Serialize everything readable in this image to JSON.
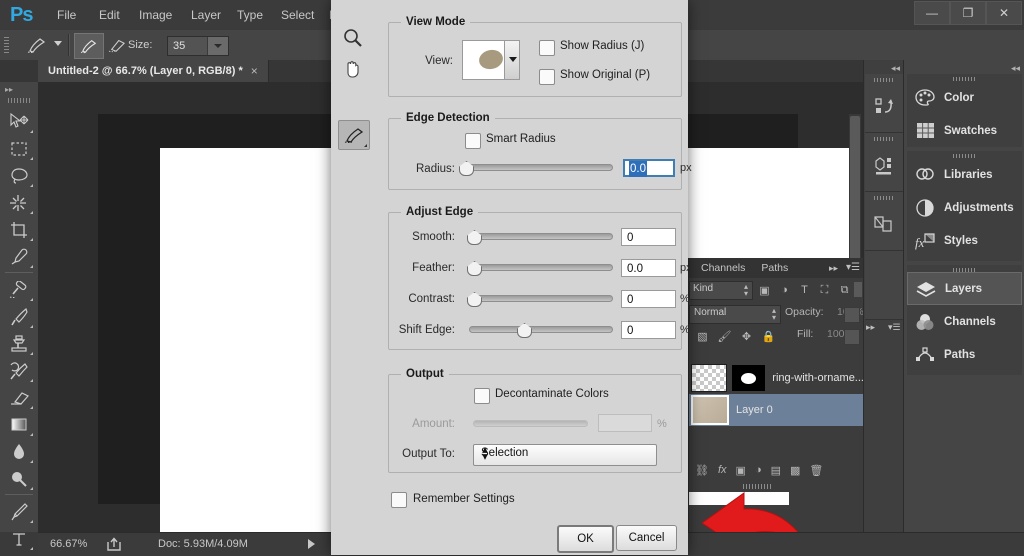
{
  "app": {
    "logo": "Ps",
    "menus": [
      "File",
      "Edit",
      "Image",
      "Layer",
      "Type",
      "Select",
      "F"
    ],
    "window_controls": {
      "minimize": "—",
      "restore": "❐",
      "close": "✕"
    }
  },
  "options_bar": {
    "size_label": "Size:",
    "size_value": "35"
  },
  "document_tab": {
    "title": "Untitled-2 @ 66.7% (Layer 0, RGB/8) *",
    "close": "×"
  },
  "toolbar": {
    "collapse": "▸▸",
    "tools": [
      {
        "name": "move-tool",
        "glyph": "move"
      },
      {
        "name": "rectangular-marquee-tool",
        "glyph": "marquee"
      },
      {
        "name": "lasso-tool",
        "glyph": "lasso"
      },
      {
        "name": "magic-wand-tool",
        "glyph": "wand"
      },
      {
        "name": "crop-tool",
        "glyph": "crop"
      },
      {
        "name": "eyedropper-tool",
        "glyph": "eyedropper"
      },
      {
        "name": "spot-healing-brush-tool",
        "glyph": "healing"
      },
      {
        "name": "brush-tool",
        "glyph": "brush"
      },
      {
        "name": "clone-stamp-tool",
        "glyph": "stamp"
      },
      {
        "name": "history-brush-tool",
        "glyph": "historybrush"
      },
      {
        "name": "eraser-tool",
        "glyph": "eraser"
      },
      {
        "name": "gradient-tool",
        "glyph": "gradient"
      },
      {
        "name": "blur-tool",
        "glyph": "blur"
      },
      {
        "name": "dodge-tool",
        "glyph": "dodge"
      },
      {
        "name": "pen-tool",
        "glyph": "pen"
      },
      {
        "name": "type-tool",
        "glyph": "type"
      }
    ]
  },
  "status_bar": {
    "zoom": "66.67%",
    "doc_info": "Doc: 5.93M/4.09M"
  },
  "layers_panel": {
    "tabs": [
      "Channels",
      "Paths"
    ],
    "kind_filter": "Kind",
    "blend_mode": "Normal",
    "opacity_label": "Opacity:",
    "opacity_value": "100%",
    "fill_label": "Fill:",
    "fill_value": "100%",
    "layers": [
      {
        "name": "ring-with-orname...",
        "selected": false,
        "has_mask": true
      },
      {
        "name": "Layer 0",
        "selected": true,
        "has_mask": false
      }
    ]
  },
  "right_dock": {
    "collapse": "◂◂",
    "groups": [
      {
        "items": [
          {
            "label": "Color",
            "icon": "color-palette-icon",
            "active": false
          },
          {
            "label": "Swatches",
            "icon": "swatches-grid-icon",
            "active": false
          }
        ]
      },
      {
        "items": [
          {
            "label": "Libraries",
            "icon": "libraries-icon",
            "active": false
          },
          {
            "label": "Adjustments",
            "icon": "adjustments-icon",
            "active": false
          },
          {
            "label": "Styles",
            "icon": "styles-fx-icon",
            "active": false
          }
        ]
      },
      {
        "items": [
          {
            "label": "Layers",
            "icon": "layers-icon",
            "active": true
          },
          {
            "label": "Channels",
            "icon": "channels-icon",
            "active": false
          },
          {
            "label": "Paths",
            "icon": "paths-icon",
            "active": false
          }
        ]
      }
    ]
  },
  "icon_dock": {
    "collapse": "◂◂",
    "items": [
      {
        "name": "history-panel-icon"
      },
      {
        "name": "properties-panel-icon"
      },
      {
        "name": "layer-comps-panel-icon"
      }
    ]
  },
  "dialog": {
    "tools": [
      {
        "name": "zoom-tool",
        "selected": false
      },
      {
        "name": "hand-tool",
        "selected": false
      },
      {
        "name": "refine-radius-brush-tool",
        "selected": true
      }
    ],
    "view_mode": {
      "legend": "View Mode",
      "view_label": "View:",
      "show_radius": {
        "label": "Show Radius (J)",
        "checked": false
      },
      "show_original": {
        "label": "Show Original (P)",
        "checked": false
      }
    },
    "edge_detection": {
      "legend": "Edge Detection",
      "smart_radius": {
        "label": "Smart Radius",
        "checked": false
      },
      "radius_label": "Radius:",
      "radius_value": "0.0",
      "radius_unit": "px",
      "radius_slider_pct": 0
    },
    "adjust_edge": {
      "legend": "Adjust Edge",
      "rows": [
        {
          "label": "Smooth:",
          "value": "0",
          "unit": "",
          "slider_pct": 0
        },
        {
          "label": "Feather:",
          "value": "0.0",
          "unit": "px",
          "slider_pct": 0
        },
        {
          "label": "Contrast:",
          "value": "0",
          "unit": "%",
          "slider_pct": 0
        },
        {
          "label": "Shift Edge:",
          "value": "0",
          "unit": "%",
          "slider_pct": 50
        }
      ]
    },
    "output": {
      "legend": "Output",
      "decontaminate": {
        "label": "Decontaminate Colors",
        "checked": false
      },
      "amount_label": "Amount:",
      "amount_value": "",
      "amount_unit": "%",
      "output_to_label": "Output To:",
      "output_to_value": "Selection"
    },
    "remember_settings": {
      "label": "Remember Settings",
      "checked": false
    },
    "ok_label": "OK",
    "cancel_label": "Cancel"
  },
  "annotation": {
    "arrow_color": "#e11b1b"
  }
}
